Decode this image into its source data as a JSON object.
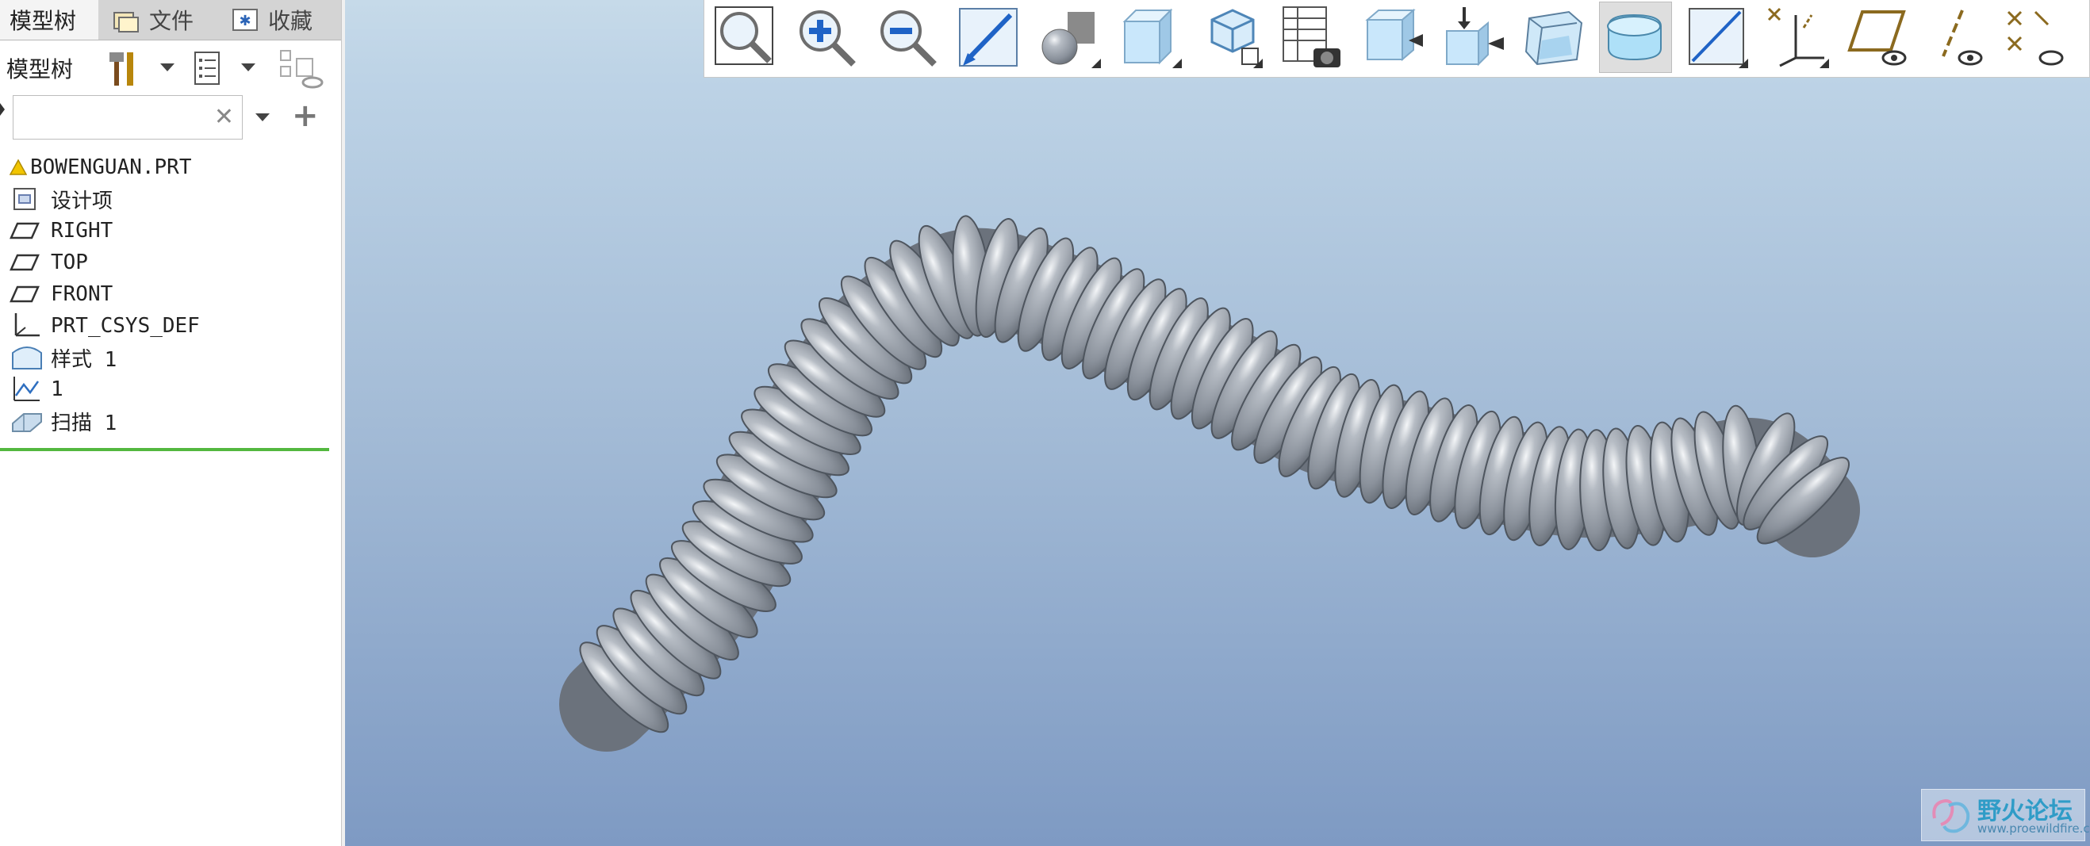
{
  "tabs": [
    {
      "label": "模型树",
      "icon": "model-tree-tab"
    },
    {
      "label": "文件",
      "icon": "folder-icon"
    },
    {
      "label": "收藏",
      "icon": "favorites-icon"
    }
  ],
  "tree": {
    "title": "模型树",
    "search_value": "",
    "items": [
      {
        "label": "BOWENGUAN.PRT",
        "icon": "part-warning-icon"
      },
      {
        "label": "设计项",
        "icon": "design-items-icon"
      },
      {
        "label": "RIGHT",
        "icon": "datum-plane-icon"
      },
      {
        "label": "TOP",
        "icon": "datum-plane-icon"
      },
      {
        "label": "FRONT",
        "icon": "datum-plane-icon"
      },
      {
        "label": "PRT_CSYS_DEF",
        "icon": "csys-icon"
      },
      {
        "label": "样式 1",
        "icon": "style-surface-icon"
      },
      {
        "label": "1",
        "icon": "datum-curve-icon"
      },
      {
        "label": "扫描 1",
        "icon": "sweep-icon"
      }
    ]
  },
  "toolbar": {
    "buttons": [
      {
        "name": "refit-icon"
      },
      {
        "name": "zoom-in-icon"
      },
      {
        "name": "zoom-out-icon"
      },
      {
        "name": "repaint-icon"
      },
      {
        "name": "perspective-icon",
        "dropdown": true
      },
      {
        "name": "named-views-icon",
        "dropdown": true
      },
      {
        "name": "display-style-icon",
        "dropdown": true
      },
      {
        "name": "view-manager-icon"
      },
      {
        "name": "section-icon"
      },
      {
        "name": "annotation-icon"
      },
      {
        "name": "hidden-line-icon"
      },
      {
        "name": "shading-icon",
        "active": true
      },
      {
        "name": "datum-display-icon",
        "dropdown": true
      },
      {
        "name": "csys-display-icon",
        "dropdown": true
      },
      {
        "name": "plane-display-icon"
      },
      {
        "name": "axis-display-icon"
      },
      {
        "name": "point-display-icon"
      }
    ]
  },
  "viewport": {
    "model": "bellows-hose",
    "background_top": "#bdd3e6",
    "background_bottom": "#7e9ac3",
    "model_color": "#8f96a0"
  },
  "watermark": {
    "title": "野火论坛",
    "url": "www.proewildfire.cn"
  }
}
